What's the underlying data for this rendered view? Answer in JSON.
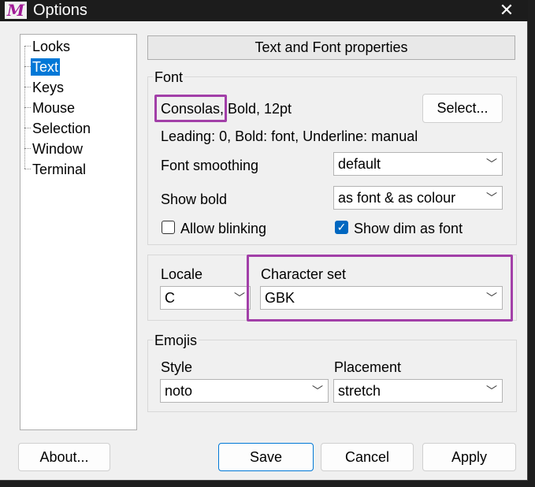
{
  "window": {
    "title": "Options",
    "logo": "M"
  },
  "sidebar": {
    "items": [
      {
        "label": "Looks",
        "selected": false
      },
      {
        "label": "Text",
        "selected": true
      },
      {
        "label": "Keys",
        "selected": false
      },
      {
        "label": "Mouse",
        "selected": false
      },
      {
        "label": "Selection",
        "selected": false
      },
      {
        "label": "Window",
        "selected": false
      },
      {
        "label": "Terminal",
        "selected": false
      }
    ]
  },
  "panel": {
    "header": "Text and Font properties"
  },
  "font": {
    "group_label": "Font",
    "name": "Consolas,",
    "style": "Bold, 12pt",
    "select_button": "Select...",
    "info": "Leading: 0, Bold: font, Underline: manual",
    "smoothing_label": "Font smoothing",
    "smoothing_value": "default",
    "show_bold_label": "Show bold",
    "show_bold_value": "as font & as colour",
    "allow_blinking_label": "Allow blinking",
    "allow_blinking_checked": false,
    "show_dim_label": "Show dim as font",
    "show_dim_checked": true
  },
  "locale": {
    "locale_label": "Locale",
    "locale_value": "C",
    "charset_label": "Character set",
    "charset_value": "GBK"
  },
  "emojis": {
    "group_label": "Emojis",
    "style_label": "Style",
    "style_value": "noto",
    "placement_label": "Placement",
    "placement_value": "stretch"
  },
  "buttons": {
    "about": "About...",
    "save": "Save",
    "cancel": "Cancel",
    "apply": "Apply"
  },
  "colors": {
    "highlight": "#a23fa8",
    "selection": "#0078d7",
    "checkbox": "#0067c0"
  }
}
